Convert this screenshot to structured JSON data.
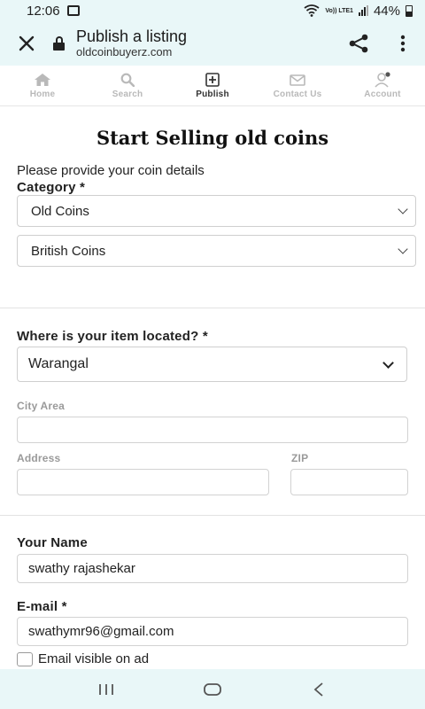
{
  "status": {
    "time": "12:06",
    "volte": "Vo)) LTE1",
    "battery": "44%"
  },
  "browser": {
    "title": "Publish a listing",
    "domain": "oldcoinbuyerz.com"
  },
  "nav": [
    {
      "label": "Home",
      "icon": "home-icon"
    },
    {
      "label": "Search",
      "icon": "search-icon"
    },
    {
      "label": "Publish",
      "icon": "plus-square-icon"
    },
    {
      "label": "Contact Us",
      "icon": "mail-icon"
    },
    {
      "label": "Account",
      "icon": "user-icon"
    }
  ],
  "form": {
    "heading": "Start Selling old coins",
    "subheading": "Please provide your coin details",
    "category_label": "Category *",
    "category_value": "Old Coins",
    "subcategory_value": "British Coins",
    "location_label": "Where is your item located? *",
    "location_value": "Warangal",
    "city_area_label": "City Area",
    "city_area_value": "",
    "address_label": "Address",
    "address_value": "",
    "zip_label": "ZIP",
    "zip_value": "",
    "name_label": "Your Name",
    "name_value": "swathy rajashekar",
    "email_label": "E-mail *",
    "email_value": "swathymr96@gmail.com",
    "email_visible_label": "Email visible on ad"
  },
  "colors": {
    "chrome_bg": "#e9f7f8",
    "nav_active": "#333333",
    "nav_inactive": "#b9b9b9"
  }
}
